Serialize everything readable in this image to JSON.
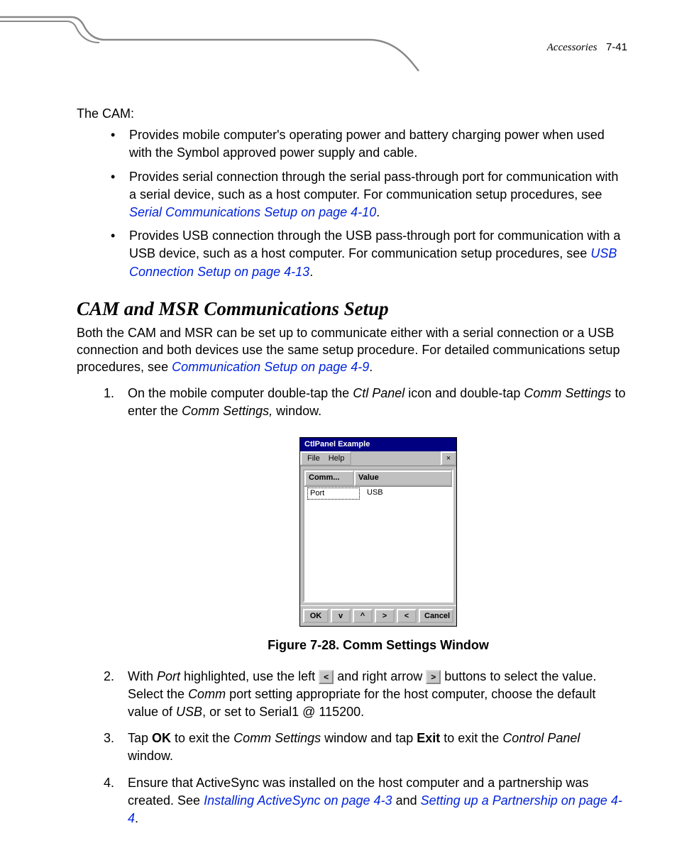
{
  "header": {
    "section": "Accessories",
    "page": "7-41"
  },
  "intro": {
    "lead": "The CAM:"
  },
  "bullets": {
    "b1": "Provides mobile computer's operating power and battery charging power when used with the Symbol approved power supply and cable.",
    "b2a": "Provides serial connection through the serial pass-through port for communication with a serial device, such as a host computer. For communication setup procedures, see ",
    "b2link": "Serial Communications Setup on page 4-10",
    "b2b": ".",
    "b3a": "Provides USB connection through the USB pass-through port for communication with a USB device, such as a host computer. For communication setup procedures, see ",
    "b3link": "USB Connection Setup on page 4-13",
    "b3b": "."
  },
  "section": {
    "title": "CAM and MSR Communications Setup"
  },
  "para": {
    "p1a": "Both the CAM and MSR can be set up to communicate either with a serial connection or a USB connection and both devices use the same setup procedure. For detailed communications setup procedures, see ",
    "p1link": "Communication Setup on page 4-9",
    "p1b": "."
  },
  "steps": {
    "s1a": "On the mobile computer double-tap the ",
    "s1i1": "Ctl Panel",
    "s1b": " icon and double-tap ",
    "s1i2": "Comm Settings",
    "s1c": " to enter the ",
    "s1i3": "Comm Settings,",
    "s1d": " window.",
    "s2a": "With ",
    "s2i1": "Port",
    "s2b": " highlighted, use the left ",
    "s2c": " and right arrow ",
    "s2d": " buttons to select the value. Select the ",
    "s2i2": "Comm",
    "s2e": " port setting appropriate for the host computer, choose the default value of ",
    "s2i3": "USB",
    "s2f": ", or set to Serial1 @ 115200.",
    "s3a": "Tap ",
    "s3b1": "OK",
    "s3c": " to exit the ",
    "s3i1": "Comm Settings",
    "s3d": " window and tap ",
    "s3b2": "Exit",
    "s3e": " to exit the ",
    "s3i2": "Control Panel",
    "s3f": " window.",
    "s4a": "Ensure that ActiveSync was installed on the host computer and a partnership was created. See ",
    "s4link1": "Installing ActiveSync on page 4-3",
    "s4mid": " and ",
    "s4link2": "Setting up a Partnership on page 4-4",
    "s4b": "."
  },
  "figure": {
    "caption": "Figure 7-28.  Comm Settings Window"
  },
  "window": {
    "title": "CtlPanel Example",
    "menu": {
      "file": "File",
      "help": "Help",
      "close": "×"
    },
    "columns": {
      "c1": "Comm...",
      "c2": "Value"
    },
    "row": {
      "name": "Port",
      "value": "USB"
    },
    "buttons": {
      "ok": "OK",
      "down": "v",
      "up": "^",
      "right": ">",
      "left": "<",
      "cancel": "Cancel"
    }
  },
  "inline_arrows": {
    "left": "<",
    "right": ">"
  }
}
